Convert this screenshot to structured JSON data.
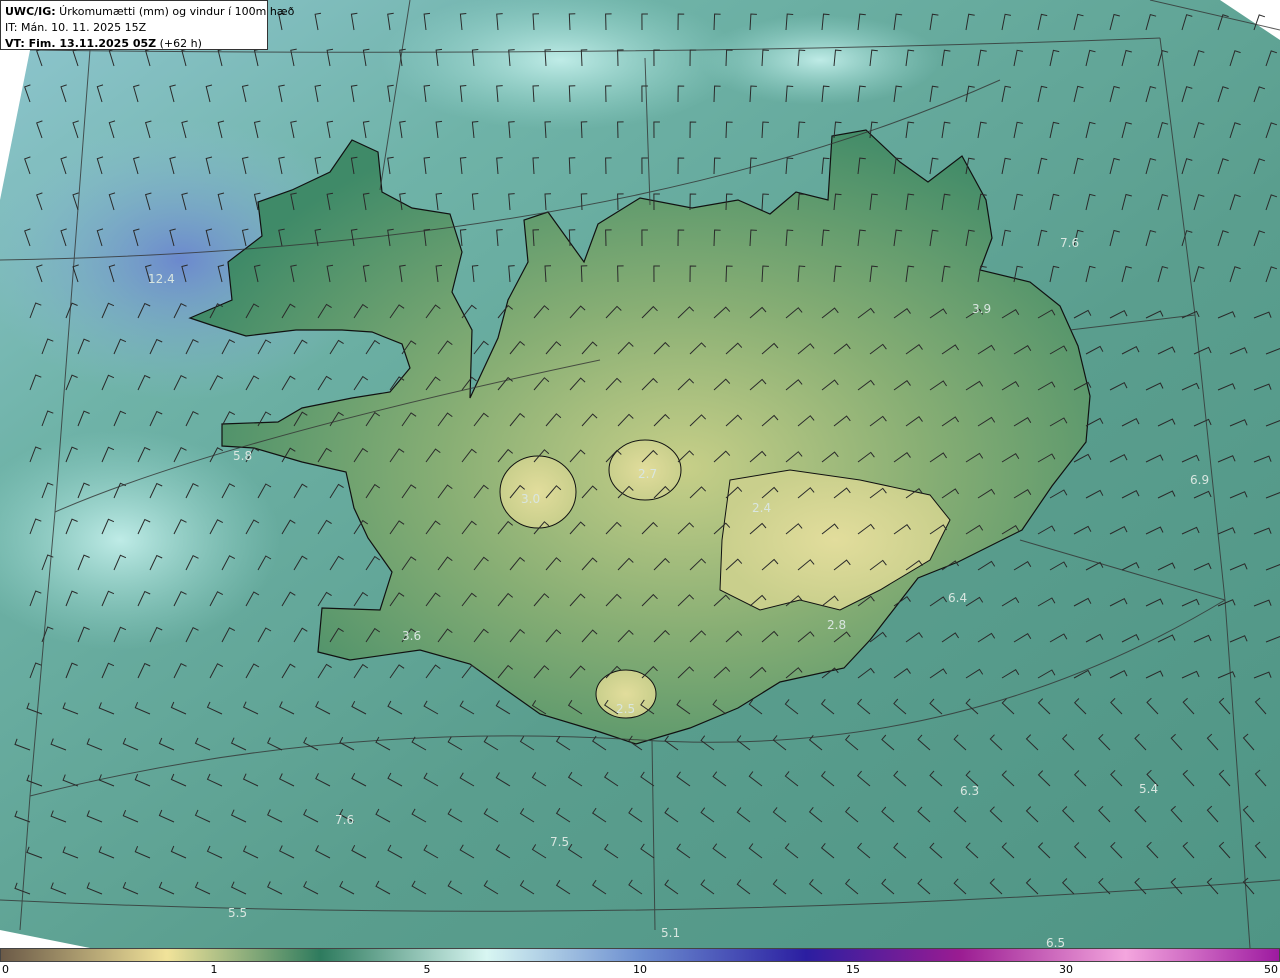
{
  "header": {
    "model": "UWC/IG:",
    "field": " Úrkomumætti (mm) og vindur í 100m hæð",
    "issue_time": "IT: Mán. 10. 11. 2025 15Z",
    "valid_prefix": "VT: Fim. 13.11.2025 05Z",
    "valid_suffix": " (+62 h)"
  },
  "map_values": [
    "12.4",
    "5.8",
    "3.0",
    "2.7",
    "2.4",
    "3.9",
    "7.6",
    "6.9",
    "6.4",
    "2.8",
    "3.6",
    "2.5",
    "6.3",
    "5.4",
    "7.6",
    "7.5",
    "5.5",
    "5.1",
    "6.5"
  ],
  "colorbar": {
    "ticks": [
      "0",
      "1",
      "5",
      "10",
      "15",
      "30",
      "50"
    ],
    "colors": [
      "#6b5a47",
      "#f1e39a",
      "#2e7b5e",
      "#d8f6f2",
      "#6c8ed0",
      "#2b1ea1",
      "#9a1c92",
      "#f4a6de",
      "#9d1aa0"
    ]
  },
  "colors": {
    "land_high": "#d3d993",
    "land_mid": "#5d9f74",
    "sea": "#5ea694",
    "sea_light": "#a8e6e0",
    "wet_blue": "#6b8fd0",
    "coast": "#111111"
  }
}
